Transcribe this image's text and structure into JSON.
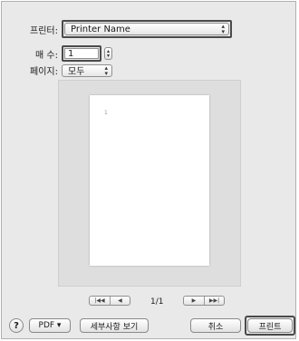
{
  "printer": {
    "label": "프린터:",
    "value": "Printer Name"
  },
  "copies": {
    "label": "매 수:",
    "value": "1"
  },
  "pages": {
    "label": "페이지:",
    "value": "모두"
  },
  "preview": {
    "page_mark": "1",
    "page_count": "1/1"
  },
  "navigation": {
    "first_icon": "first-page-icon",
    "prev_icon": "previous-page-icon",
    "next_icon": "next-page-icon",
    "last_icon": "last-page-icon"
  },
  "footer": {
    "help": "?",
    "pdf": "PDF ▾",
    "details": "세부사항 보기",
    "cancel": "취소",
    "print": "프린트"
  },
  "icons": {
    "help": "help-icon",
    "updown": "updown-arrows-icon",
    "stepper": "stepper-icon"
  }
}
